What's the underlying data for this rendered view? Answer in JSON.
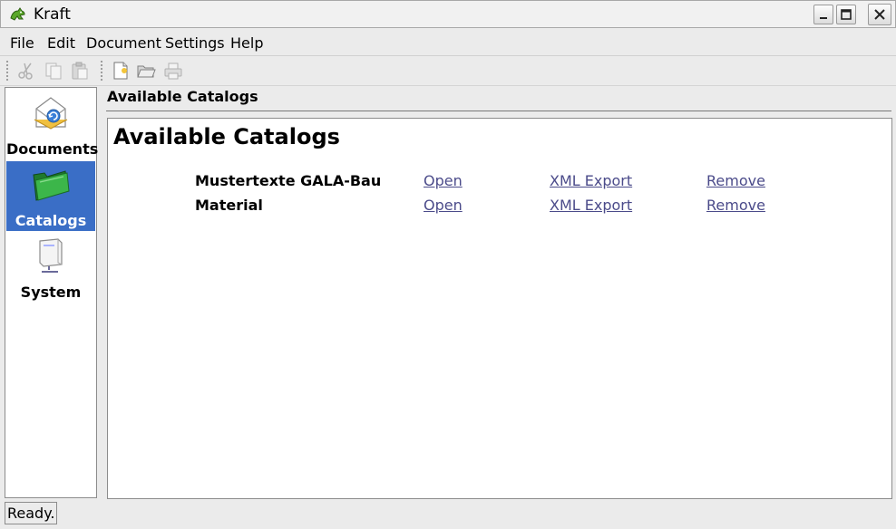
{
  "window": {
    "title": "Kraft"
  },
  "menubar": {
    "items": [
      {
        "label": "File"
      },
      {
        "label": "Edit"
      },
      {
        "label": "Document"
      },
      {
        "label": "Settings"
      },
      {
        "label": "Help"
      }
    ]
  },
  "toolbar": {
    "icons": [
      "cut-icon",
      "copy-icon",
      "paste-icon",
      "new-document-icon",
      "open-folder-icon",
      "print-icon"
    ]
  },
  "sidebar": {
    "items": [
      {
        "label": "Documents",
        "icon": "documents-envelope-icon",
        "selected": false
      },
      {
        "label": "Catalogs",
        "icon": "catalogs-folder-icon",
        "selected": true
      },
      {
        "label": "System",
        "icon": "system-computer-icon",
        "selected": false
      }
    ]
  },
  "main": {
    "heading": "Available Catalogs",
    "content_title": "Available Catalogs",
    "catalogs": [
      {
        "name": "Mustertexte GALA-Bau",
        "open": "Open",
        "export": "XML Export",
        "remove": "Remove"
      },
      {
        "name": "Material",
        "open": "Open",
        "export": "XML Export",
        "remove": "Remove"
      }
    ]
  },
  "status": {
    "text": "Ready."
  },
  "colors": {
    "selection": "#3a6ec6",
    "link": "#4b4b8a"
  }
}
